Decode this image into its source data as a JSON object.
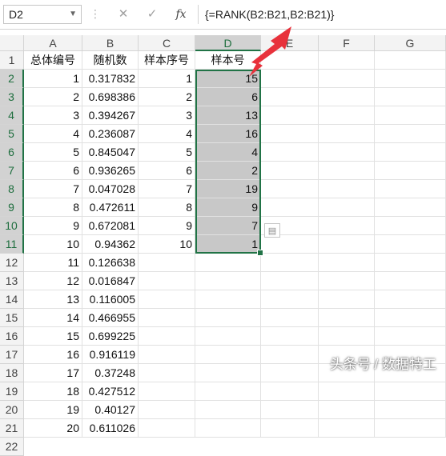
{
  "formula_bar": {
    "name_box": "D2",
    "formula": "{=RANK(B2:B21,B2:B21)}",
    "fx_label": "fx"
  },
  "columns": [
    "A",
    "B",
    "C",
    "D",
    "E",
    "F",
    "G"
  ],
  "rows": [
    "1",
    "2",
    "3",
    "4",
    "5",
    "6",
    "7",
    "8",
    "9",
    "10",
    "11",
    "12",
    "13",
    "14",
    "15",
    "16",
    "17",
    "18",
    "19",
    "20",
    "21",
    "22"
  ],
  "headers": {
    "A": "总体编号",
    "B": "随机数",
    "C": "样本序号",
    "D": "样本号"
  },
  "data": {
    "A": [
      "1",
      "2",
      "3",
      "4",
      "5",
      "6",
      "7",
      "8",
      "9",
      "10",
      "11",
      "12",
      "13",
      "14",
      "15",
      "16",
      "17",
      "18",
      "19",
      "20"
    ],
    "B": [
      "0.317832",
      "0.698386",
      "0.394267",
      "0.236087",
      "0.845047",
      "0.936265",
      "0.047028",
      "0.472611",
      "0.672081",
      "0.94362",
      "0.126638",
      "0.016847",
      "0.116005",
      "0.466955",
      "0.699225",
      "0.916119",
      "0.37248",
      "0.427512",
      "0.40127",
      "0.611026"
    ],
    "C": [
      "1",
      "2",
      "3",
      "4",
      "5",
      "6",
      "7",
      "8",
      "9",
      "10"
    ],
    "D": [
      "15",
      "6",
      "13",
      "16",
      "4",
      "2",
      "19",
      "9",
      "7",
      "1"
    ]
  },
  "accent_color": "#217346",
  "annotation_arrow_color": "#e8313b",
  "quick_analysis_icon": "quick-analysis-icon",
  "watermark": "头条号 / 数据特工"
}
